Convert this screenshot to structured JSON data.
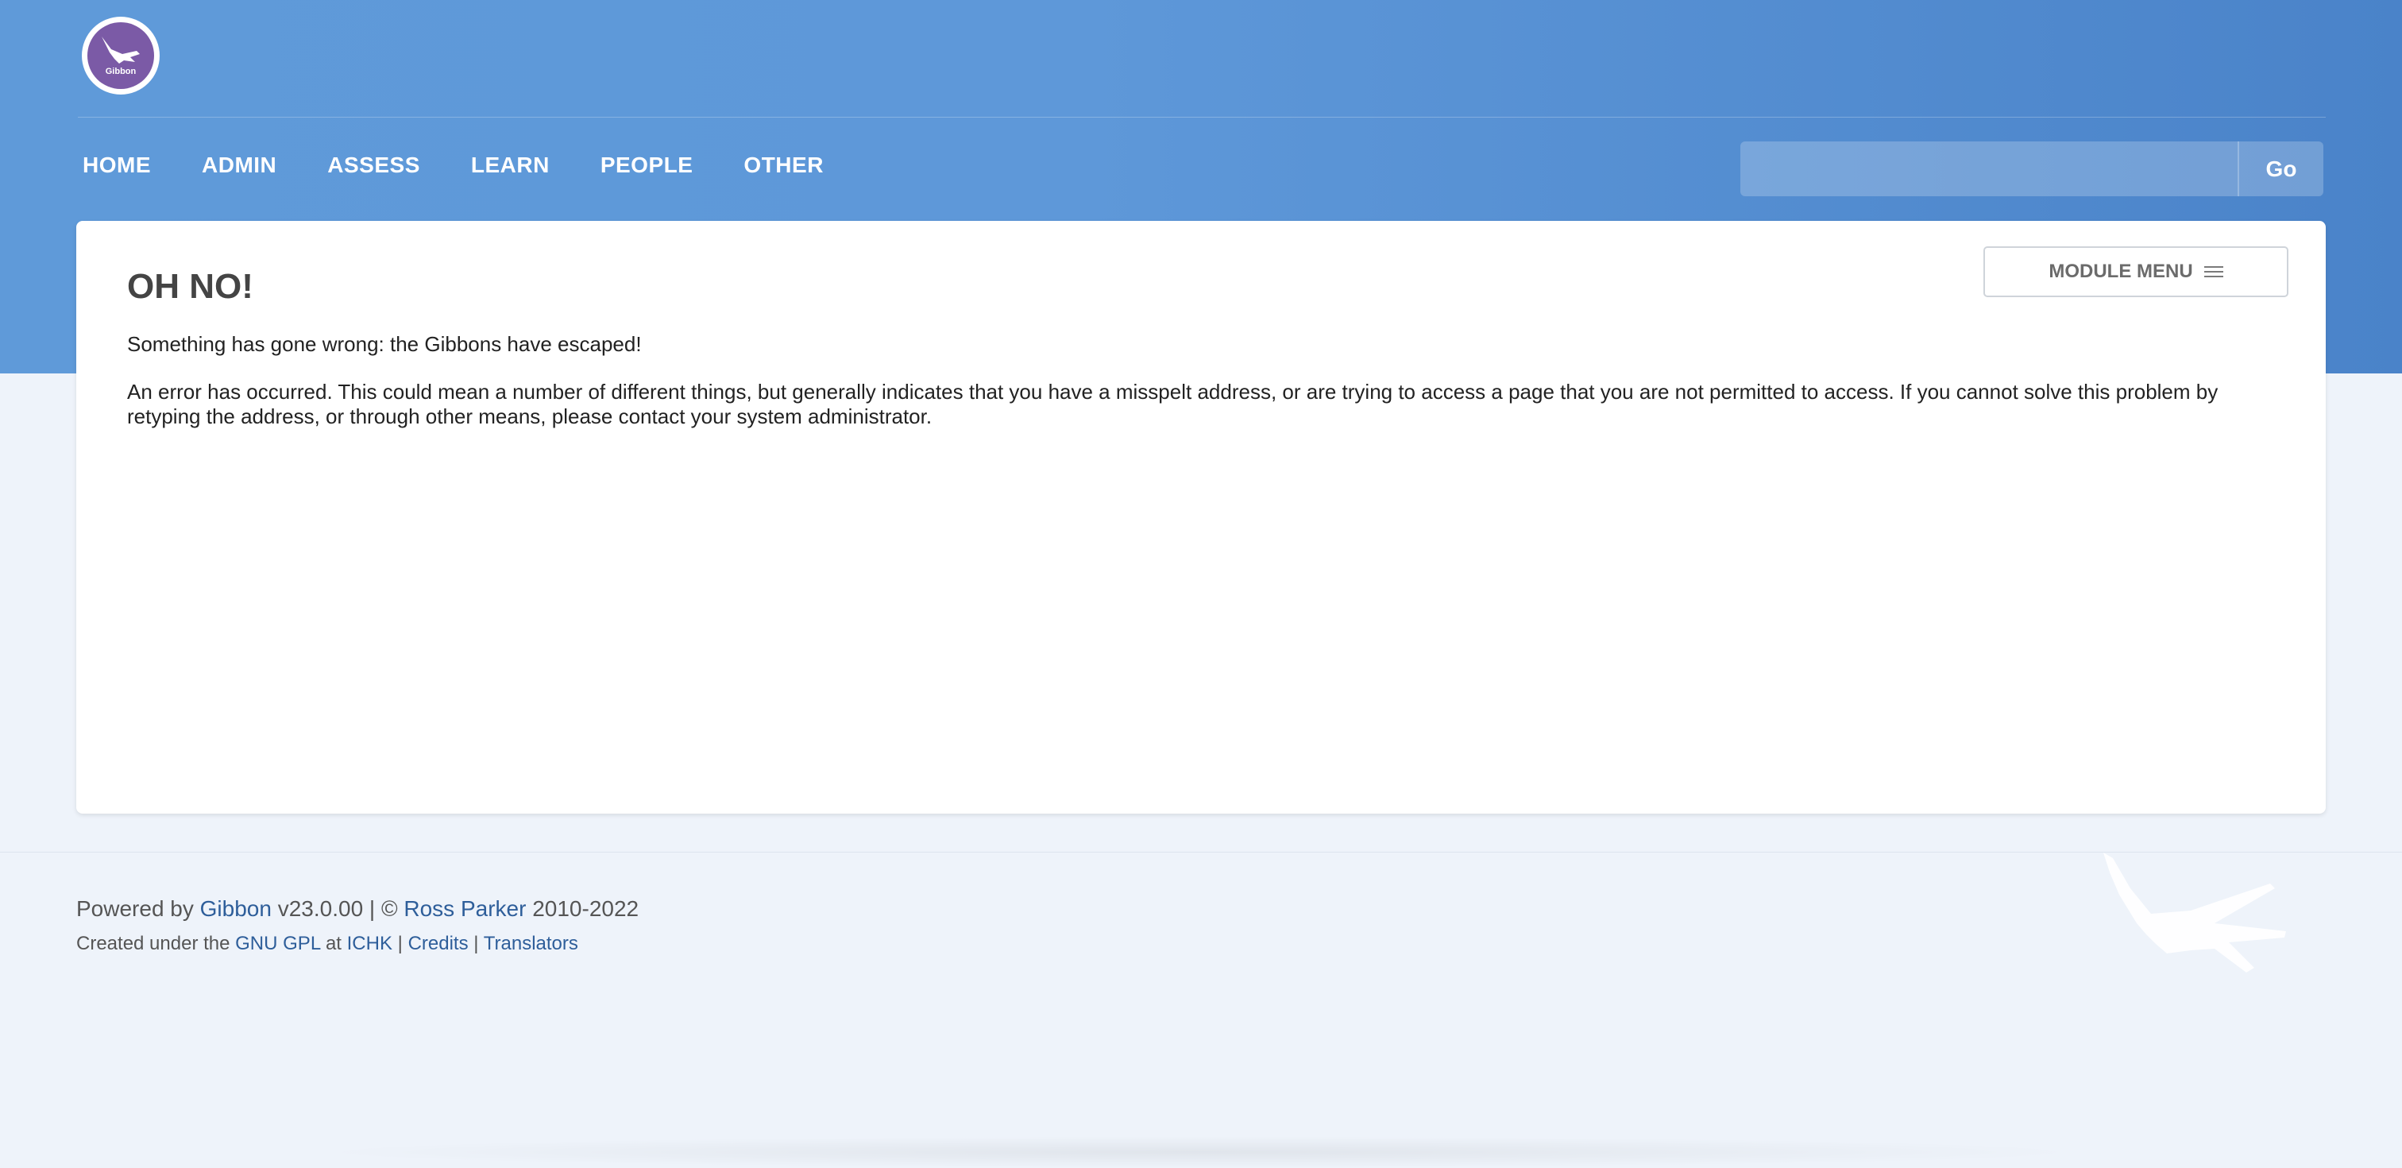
{
  "header": {
    "logo_text": "Gibbon",
    "nav": [
      {
        "label": "HOME"
      },
      {
        "label": "ADMIN"
      },
      {
        "label": "ASSESS"
      },
      {
        "label": "LEARN"
      },
      {
        "label": "PEOPLE"
      },
      {
        "label": "OTHER"
      }
    ],
    "search": {
      "value": "",
      "placeholder": "",
      "button_label": "Go"
    }
  },
  "main": {
    "module_menu_label": "MODULE MENU",
    "title": "OH NO!",
    "message_short": "Something has gone wrong: the Gibbons have escaped!",
    "message_long": "An error has occurred. This could mean a number of different things, but generally indicates that you have a misspelt address, or are trying to access a page that you are not permitted to access. If you cannot solve this problem by retyping the address, or through other means, please contact your system administrator."
  },
  "footer": {
    "powered_by_prefix": "Powered by ",
    "gibbon_link": "Gibbon",
    "version_text": " v23.0.00 | © ",
    "author_link": "Ross Parker",
    "years": " 2010-2022",
    "created_prefix": "Created under the ",
    "gpl_link": "GNU GPL",
    "at_text": " at ",
    "ichk_link": "ICHK",
    "sep1": " | ",
    "credits_link": "Credits",
    "sep2": " | ",
    "translators_link": "Translators"
  },
  "colors": {
    "header_blue": "#5e98d9",
    "logo_purple": "#7b5aa6",
    "link_blue": "#2e5e9a",
    "page_bg": "#eef3fa"
  },
  "icons": {
    "logo": "gibbon-logo-icon",
    "module_menu": "hamburger-icon",
    "footer_decoration": "gibbon-silhouette-icon"
  }
}
